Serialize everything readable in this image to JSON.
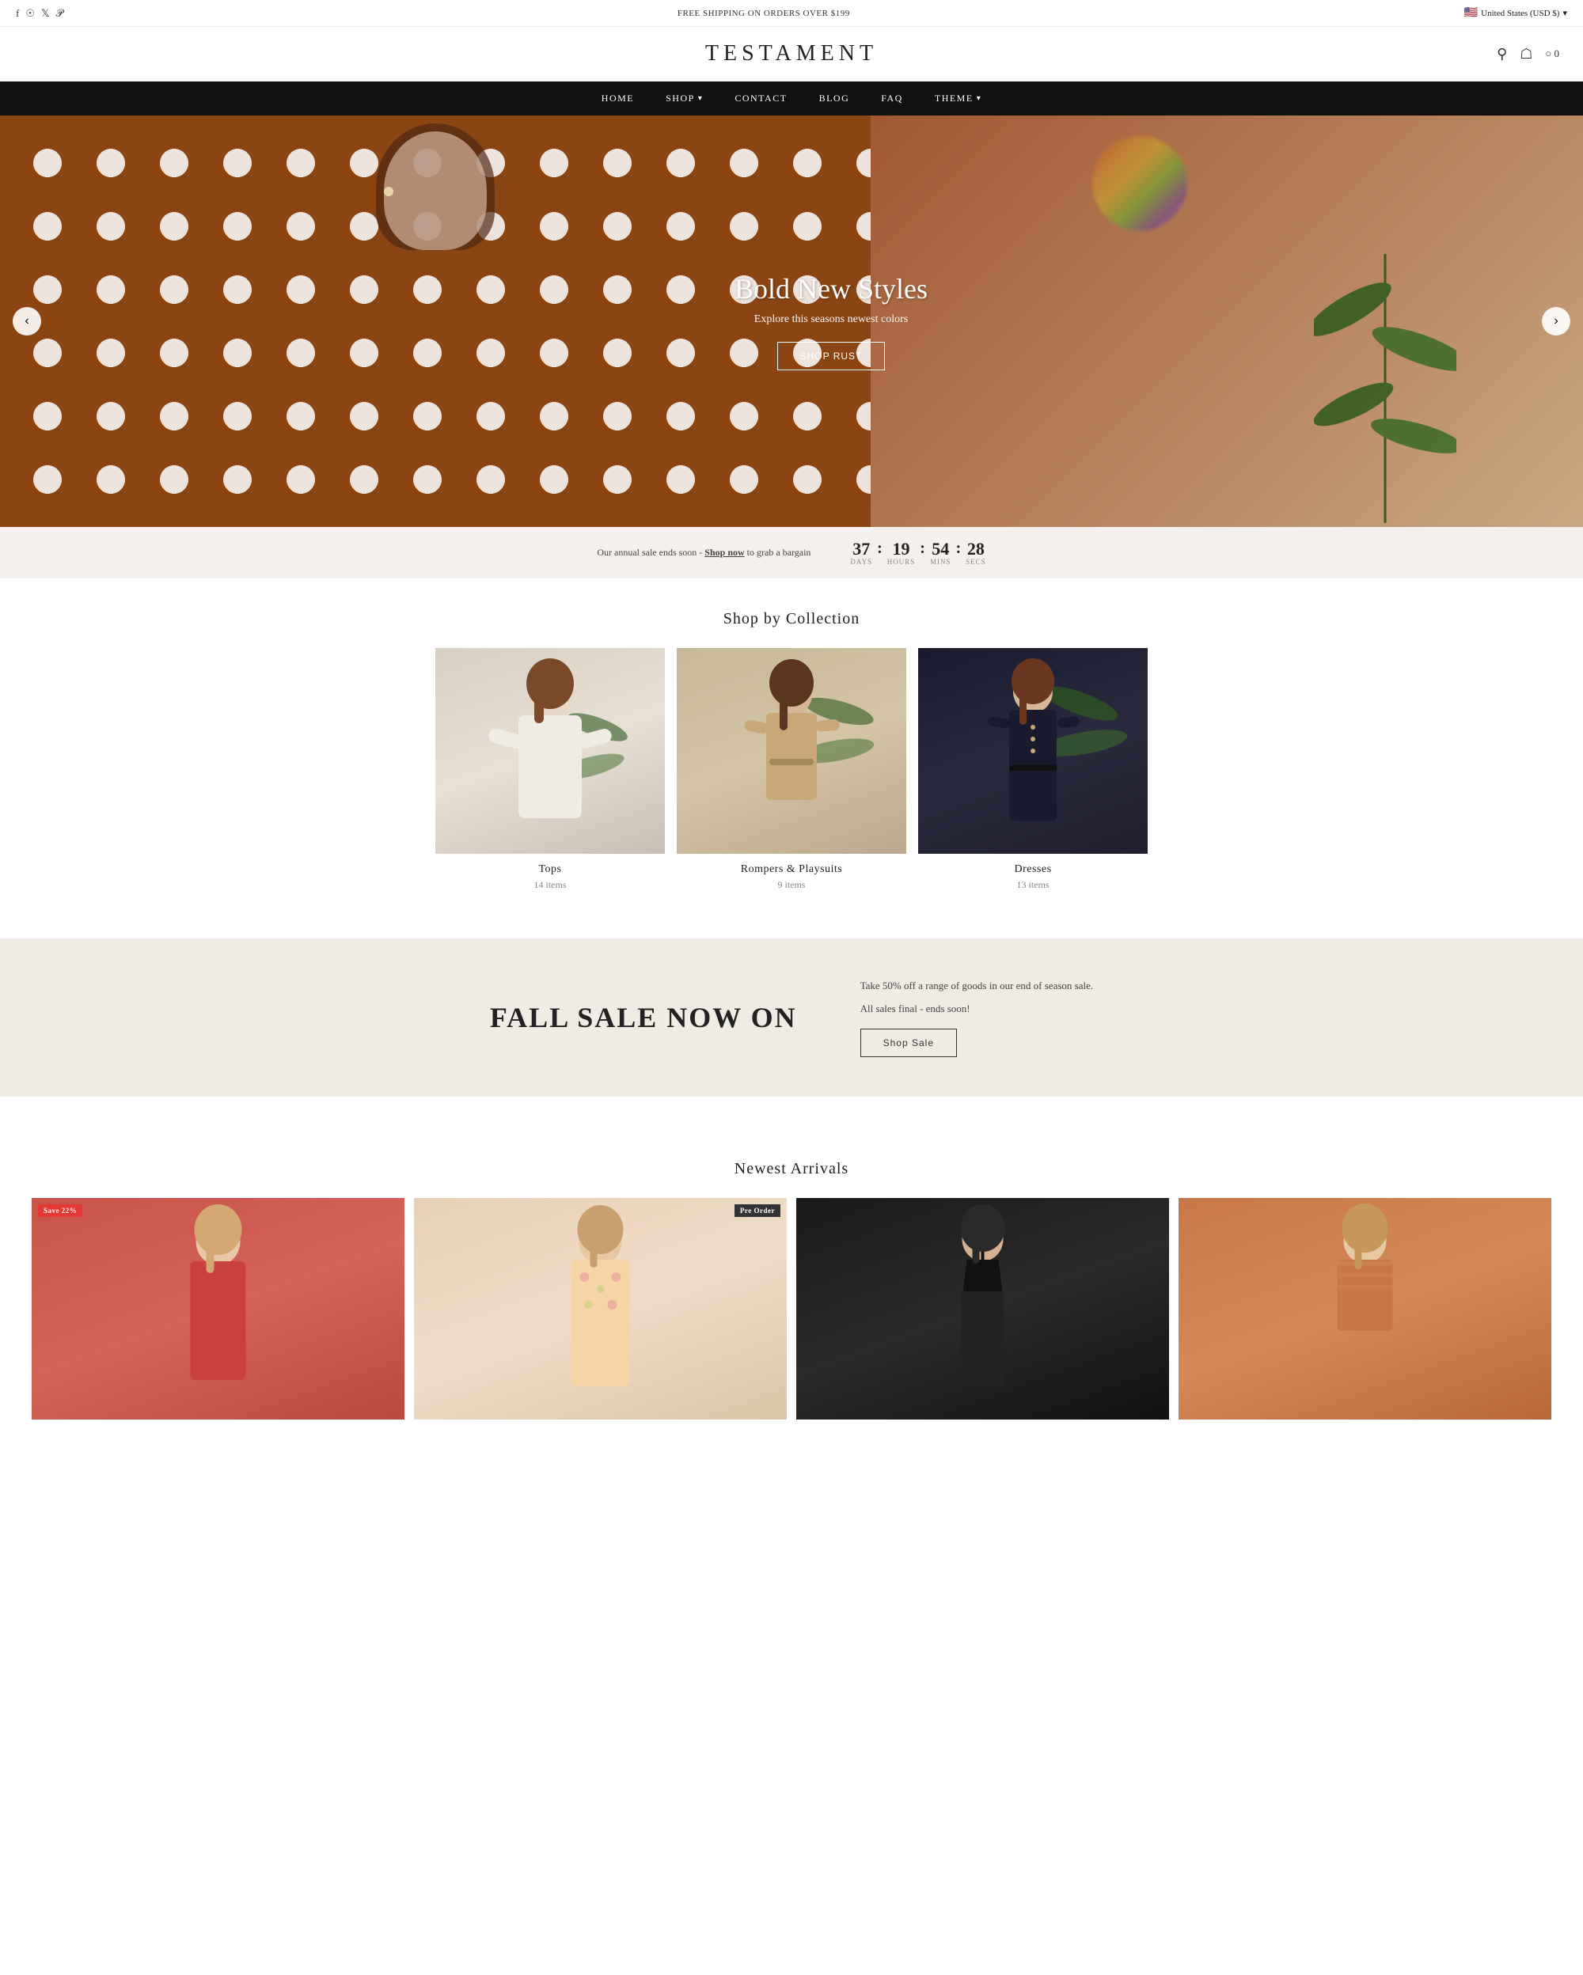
{
  "topbar": {
    "shipping_msg": "FREE SHIPPING ON ORDERS OVER $199",
    "region": "United States (USD $)",
    "social_icons": [
      "facebook",
      "instagram",
      "twitter",
      "pinterest"
    ]
  },
  "header": {
    "logo": "TESTAMENT",
    "cart_count": "0"
  },
  "nav": {
    "items": [
      {
        "label": "HOME",
        "has_dropdown": false
      },
      {
        "label": "SHOP",
        "has_dropdown": true
      },
      {
        "label": "CONTACT",
        "has_dropdown": false
      },
      {
        "label": "BLOG",
        "has_dropdown": false
      },
      {
        "label": "FAQ",
        "has_dropdown": false
      },
      {
        "label": "THEME",
        "has_dropdown": true
      }
    ]
  },
  "hero": {
    "title": "Bold New Styles",
    "subtitle": "Explore this seasons newest colors",
    "cta_label": "Shop Rust",
    "prev_label": "‹",
    "next_label": "›"
  },
  "countdown": {
    "text_before": "Our annual sale ends soon -",
    "link_text": "Shop now",
    "text_after": "to grab a bargain",
    "days": "37",
    "hours": "19",
    "mins": "54",
    "secs": "28",
    "label_days": "Days",
    "label_hours": "Hours",
    "label_mins": "Mins",
    "label_secs": "Secs"
  },
  "collections": {
    "section_title": "Shop by Collection",
    "items": [
      {
        "name": "Tops",
        "count": "14 items",
        "theme": "tops"
      },
      {
        "name": "Rompers & Playsuits",
        "count": "9 items",
        "theme": "rompers"
      },
      {
        "name": "Dresses",
        "count": "13 items",
        "theme": "dresses"
      }
    ]
  },
  "sale_banner": {
    "title": "FALL SALE NOW ON",
    "description_line1": "Take 50% off a range of goods in our end of season sale.",
    "description_line2": "All sales final - ends soon!",
    "cta_label": "Shop Sale"
  },
  "newest_arrivals": {
    "section_title": "Newest Arrivals",
    "items": [
      {
        "badge": "Save 22%",
        "badge_type": "sale",
        "theme": "red"
      },
      {
        "badge": "Pre Order",
        "badge_type": "preorder",
        "theme": "floral"
      },
      {
        "badge": null,
        "theme": "black"
      },
      {
        "badge": null,
        "theme": "rust"
      }
    ]
  }
}
